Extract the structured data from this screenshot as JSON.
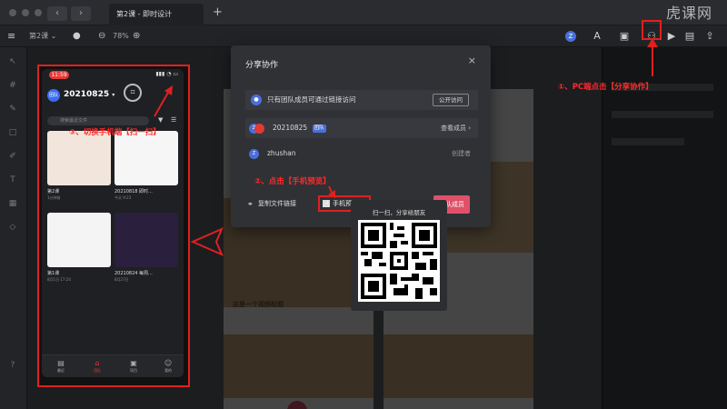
{
  "titlebar": {
    "tab_title": "第2课 - 即时设计",
    "tab_add": "+",
    "watermark": "虎课网"
  },
  "toolbar": {
    "page_name": "第2课",
    "zoom": "78%",
    "avatar_letter": "Z",
    "page_dropdown_glyph": "⌄"
  },
  "mobile": {
    "time": "11:59",
    "signal": "▮▮▮ ◔ ▭",
    "team_avatar": "团队",
    "team_name": "20210825",
    "search_placeholder": "搜索最近文件",
    "files": [
      {
        "title": "第2课",
        "subtitle": "1分钟前"
      },
      {
        "title": "20210818 即时...",
        "subtitle": "今天 9:23"
      },
      {
        "title": "第1课",
        "subtitle": "8月1日 17:24"
      },
      {
        "title": "20210824 每周...",
        "subtitle": "8月27日"
      }
    ],
    "nav": [
      "最近",
      "团队",
      "项目",
      "我的"
    ]
  },
  "dialog": {
    "title": "分享协作",
    "close": "×",
    "access_text": "只有团队成员可通过链接访问",
    "access_button": "公开访问",
    "team_row_name": "20210825",
    "team_badge": "团队",
    "view_members": "查看成员",
    "member_name": "zhushan",
    "member_role": "创建者",
    "copy_link": "复制文件链接",
    "mobile_preview": "手机预览",
    "invite_button": "团队成员"
  },
  "qr_popover": {
    "caption": "扫一扫，分享给朋友"
  },
  "canvas": {
    "post_title": "这是一个视频标题"
  },
  "annotations": {
    "step1": "①、PC端点击【分享协作】",
    "step2": "②、点击【手机预览】",
    "step3": "③、切换手机端【扫一扫】"
  },
  "colors": {
    "annotation_red": "#e02020",
    "accent_blue": "#4a6fd8",
    "invite_pink": "#e0506a"
  }
}
